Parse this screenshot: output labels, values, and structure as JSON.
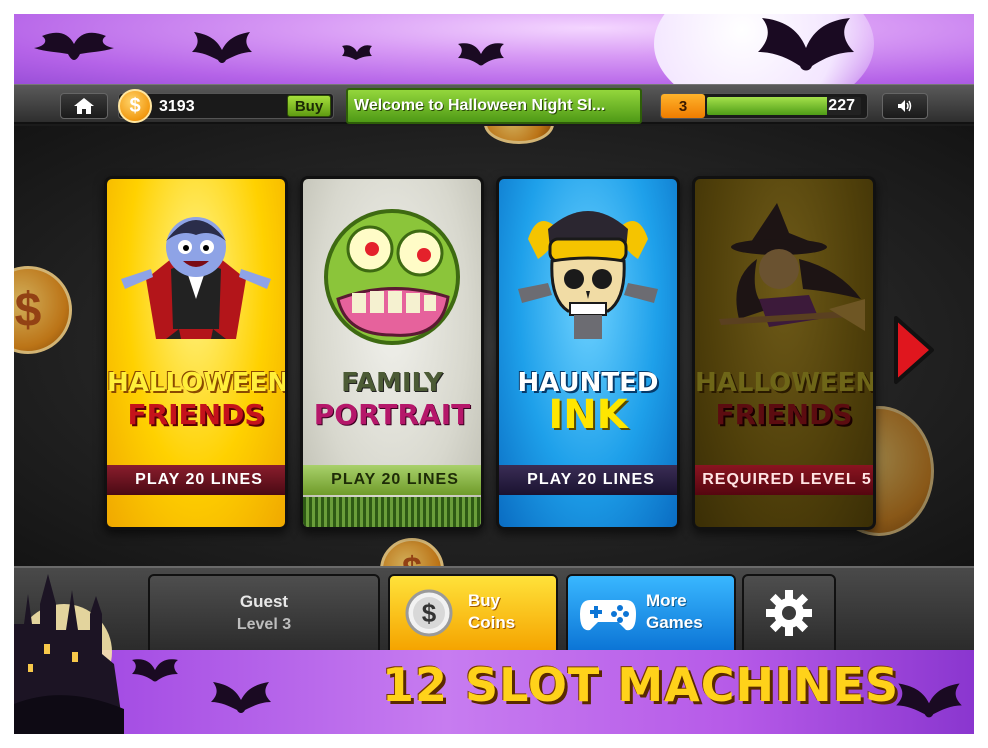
{
  "top_bar": {
    "coins": "3193",
    "buy_label": "Buy",
    "currency_symbol": "$",
    "welcome": "Welcome to Halloween Night Sl...",
    "level": "3",
    "xp_fraction": 0.78,
    "xp_value": "227"
  },
  "games": [
    {
      "title_line1": "HALLOWEEN",
      "title_line2": "FRIENDS",
      "ribbon": "PLAY 20 LINES",
      "locked": false
    },
    {
      "title_line1": "FAMILY",
      "title_line2": "PORTRAIT",
      "ribbon": "PLAY 20 LINES",
      "locked": false
    },
    {
      "title_line1": "HAUNTED",
      "title_line2": "INK",
      "ribbon": "PLAY 20 LINES",
      "locked": false
    },
    {
      "title_line1": "HALLOWEEN",
      "title_line2": "FRIENDS",
      "ribbon": "REQUIRED LEVEL 5",
      "locked": true
    }
  ],
  "bottom_bar": {
    "guest_name": "Guest",
    "guest_level": "Level 3",
    "buy_coins_line1": "Buy",
    "buy_coins_line2": "Coins",
    "more_games_line1": "More",
    "more_games_line2": "Games"
  },
  "promo": {
    "text": "12 SLOT MACHINES"
  },
  "icons": {
    "home": "home-icon",
    "coin": "dollar-coin-icon",
    "sound": "speaker-icon",
    "next": "next-arrow-icon",
    "gamepad": "gamepad-icon",
    "settings": "gear-icon"
  },
  "colors": {
    "accent_green": "#5f9c12",
    "level_orange": "#ef7c00",
    "buy_coins_yellow": "#f5a400",
    "more_games_blue": "#0c75d6",
    "promo_purple": "#b65ae8",
    "promo_text": "#ffd21a"
  }
}
